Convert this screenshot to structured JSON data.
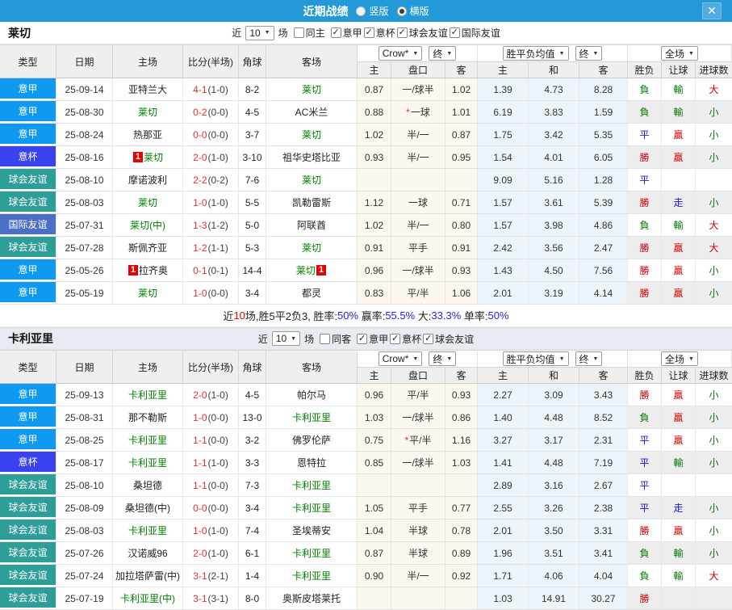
{
  "titlebar": {
    "title": "近期战绩",
    "radio_vertical": "竖版",
    "radio_horizontal": "横版",
    "selected": "横版",
    "close_label": "✕",
    "bar_color": "#2399d8"
  },
  "filters": {
    "near_label": "近",
    "near_value": "10",
    "games_label": "场"
  },
  "columns": {
    "left": [
      "类型",
      "日期",
      "主场",
      "比分(半场)",
      "角球",
      "客场"
    ],
    "right": [
      "主",
      "盘口",
      "客",
      "主",
      "和",
      "客",
      "胜负",
      "让球",
      "进球数"
    ],
    "sel_company": "Crow*",
    "sel_final1": "终",
    "sel_avg": "胜平负均值",
    "sel_final2": "终",
    "sel_scope": "全场"
  },
  "type_colors": {
    "意甲": "#0d9af0",
    "意杯": "#3a41ee",
    "球会友谊": "#2e9e99",
    "国际友谊": "#4a6fc4"
  },
  "palette": {
    "r": "#d40000",
    "b": "#1616d6",
    "g": "#067806"
  },
  "focus_team_color": "#008000",
  "sections": [
    {
      "team": "莱切",
      "same_label": "同主",
      "leagues": [
        "意甲",
        "意杯",
        "球会友谊",
        "国际友谊"
      ],
      "rows": [
        {
          "type": "意甲",
          "date": "25-09-14",
          "home": "亚特兰大",
          "home_focus": false,
          "home_rc": "",
          "home_rc_pos": "pre",
          "score": "4-1",
          "half": "(1-0)",
          "corner": "8-2",
          "away": "莱切",
          "away_focus": true,
          "away_rc": "",
          "away_rc_pos": "post",
          "h": "0.87",
          "hcap": "一/球半",
          "hcap_star": false,
          "a": "1.02",
          "avg_h": "1.39",
          "avg_d": "4.73",
          "avg_a": "8.28",
          "wl": "負",
          "wl_c": "g",
          "hc": "輸",
          "hc_c": "g",
          "ou": "大",
          "ou_c": "r"
        },
        {
          "type": "意甲",
          "date": "25-08-30",
          "home": "莱切",
          "home_focus": true,
          "home_rc": "",
          "home_rc_pos": "pre",
          "score": "0-2",
          "half": "(0-0)",
          "corner": "4-5",
          "away": "AC米兰",
          "away_focus": false,
          "away_rc": "",
          "away_rc_pos": "post",
          "h": "0.88",
          "hcap": "一球",
          "hcap_star": true,
          "a": "1.01",
          "avg_h": "6.19",
          "avg_d": "3.83",
          "avg_a": "1.59",
          "wl": "負",
          "wl_c": "g",
          "hc": "輸",
          "hc_c": "g",
          "ou": "小",
          "ou_c": "g"
        },
        {
          "type": "意甲",
          "date": "25-08-24",
          "home": "热那亚",
          "home_focus": false,
          "home_rc": "",
          "home_rc_pos": "pre",
          "score": "0-0",
          "half": "(0-0)",
          "corner": "3-7",
          "away": "莱切",
          "away_focus": true,
          "away_rc": "",
          "away_rc_pos": "post",
          "h": "1.02",
          "hcap": "半/一",
          "hcap_star": false,
          "a": "0.87",
          "avg_h": "1.75",
          "avg_d": "3.42",
          "avg_a": "5.35",
          "wl": "平",
          "wl_c": "b",
          "hc": "贏",
          "hc_c": "r",
          "ou": "小",
          "ou_c": "g"
        },
        {
          "type": "意杯",
          "date": "25-08-16",
          "home": "莱切",
          "home_focus": true,
          "home_rc": "1",
          "home_rc_pos": "pre",
          "score": "2-0",
          "half": "(1-0)",
          "corner": "3-10",
          "away": "祖华史塔比亚",
          "away_focus": false,
          "away_rc": "",
          "away_rc_pos": "post",
          "h": "0.93",
          "hcap": "半/一",
          "hcap_star": false,
          "a": "0.95",
          "avg_h": "1.54",
          "avg_d": "4.01",
          "avg_a": "6.05",
          "wl": "勝",
          "wl_c": "r",
          "hc": "贏",
          "hc_c": "r",
          "ou": "小",
          "ou_c": "g"
        },
        {
          "type": "球会友谊",
          "date": "25-08-10",
          "home": "摩诺波利",
          "home_focus": false,
          "home_rc": "",
          "home_rc_pos": "pre",
          "score": "2-2",
          "half": "(0-2)",
          "corner": "7-6",
          "away": "莱切",
          "away_focus": true,
          "away_rc": "",
          "away_rc_pos": "post",
          "h": "",
          "hcap": "",
          "hcap_star": false,
          "a": "",
          "avg_h": "9.09",
          "avg_d": "5.16",
          "avg_a": "1.28",
          "wl": "平",
          "wl_c": "b",
          "hc": "",
          "hc_c": "b",
          "ou": "",
          "ou_c": "g"
        },
        {
          "type": "球会友谊",
          "date": "25-08-03",
          "home": "莱切",
          "home_focus": true,
          "home_rc": "",
          "home_rc_pos": "pre",
          "score": "1-0",
          "half": "(1-0)",
          "corner": "5-5",
          "away": "凯勒雷斯",
          "away_focus": false,
          "away_rc": "",
          "away_rc_pos": "post",
          "h": "1.12",
          "hcap": "一球",
          "hcap_star": false,
          "a": "0.71",
          "avg_h": "1.57",
          "avg_d": "3.61",
          "avg_a": "5.39",
          "wl": "勝",
          "wl_c": "r",
          "hc": "走",
          "hc_c": "b",
          "ou": "小",
          "ou_c": "g"
        },
        {
          "type": "国际友谊",
          "date": "25-07-31",
          "home": "莱切(中)",
          "home_focus": true,
          "home_rc": "",
          "home_rc_pos": "pre",
          "score": "1-3",
          "half": "(1-2)",
          "corner": "5-0",
          "away": "阿联酋",
          "away_focus": false,
          "away_rc": "",
          "away_rc_pos": "post",
          "h": "1.02",
          "hcap": "半/一",
          "hcap_star": false,
          "a": "0.80",
          "avg_h": "1.57",
          "avg_d": "3.98",
          "avg_a": "4.86",
          "wl": "負",
          "wl_c": "g",
          "hc": "輸",
          "hc_c": "g",
          "ou": "大",
          "ou_c": "r"
        },
        {
          "type": "球会友谊",
          "date": "25-07-28",
          "home": "斯佩齐亚",
          "home_focus": false,
          "home_rc": "",
          "home_rc_pos": "pre",
          "score": "1-2",
          "half": "(1-1)",
          "corner": "5-3",
          "away": "莱切",
          "away_focus": true,
          "away_rc": "",
          "away_rc_pos": "post",
          "h": "0.91",
          "hcap": "平手",
          "hcap_star": false,
          "a": "0.91",
          "avg_h": "2.42",
          "avg_d": "3.56",
          "avg_a": "2.47",
          "wl": "勝",
          "wl_c": "r",
          "hc": "贏",
          "hc_c": "r",
          "ou": "大",
          "ou_c": "r"
        },
        {
          "type": "意甲",
          "date": "25-05-26",
          "home": "拉齐奥",
          "home_focus": false,
          "home_rc": "1",
          "home_rc_pos": "pre",
          "score": "0-1",
          "half": "(0-1)",
          "corner": "14-4",
          "away": "莱切",
          "away_focus": true,
          "away_rc": "1",
          "away_rc_pos": "post",
          "h": "0.96",
          "hcap": "一/球半",
          "hcap_star": false,
          "a": "0.93",
          "avg_h": "1.43",
          "avg_d": "4.50",
          "avg_a": "7.56",
          "wl": "勝",
          "wl_c": "r",
          "hc": "贏",
          "hc_c": "r",
          "ou": "小",
          "ou_c": "g"
        },
        {
          "type": "意甲",
          "date": "25-05-19",
          "home": "莱切",
          "home_focus": true,
          "home_rc": "",
          "home_rc_pos": "pre",
          "score": "1-0",
          "half": "(0-0)",
          "corner": "3-4",
          "away": "都灵",
          "away_focus": false,
          "away_rc": "",
          "away_rc_pos": "post",
          "h": "0.83",
          "hcap": "平/半",
          "hcap_star": false,
          "a": "1.06",
          "avg_h": "2.01",
          "avg_d": "3.19",
          "avg_a": "4.14",
          "wl": "勝",
          "wl_c": "r",
          "hc": "贏",
          "hc_c": "r",
          "ou": "小",
          "ou_c": "g"
        }
      ],
      "summary": [
        {
          "t": "近",
          "c": "k"
        },
        {
          "t": "10",
          "c": "r"
        },
        {
          "t": "场,胜5平2负3, 胜率:",
          "c": "k"
        },
        {
          "t": "50%",
          "c": "b"
        },
        {
          "t": " 赢率:",
          "c": "k"
        },
        {
          "t": "55.5%",
          "c": "b"
        },
        {
          "t": " 大:",
          "c": "k"
        },
        {
          "t": "33.3%",
          "c": "b"
        },
        {
          "t": " 单率:",
          "c": "k"
        },
        {
          "t": "50%",
          "c": "b"
        }
      ]
    },
    {
      "team": "卡利亚里",
      "same_label": "同客",
      "leagues": [
        "意甲",
        "意杯",
        "球会友谊"
      ],
      "rows": [
        {
          "type": "意甲",
          "date": "25-09-13",
          "home": "卡利亚里",
          "home_focus": true,
          "home_rc": "",
          "home_rc_pos": "pre",
          "score": "2-0",
          "half": "(1-0)",
          "corner": "4-5",
          "away": "帕尔马",
          "away_focus": false,
          "away_rc": "",
          "away_rc_pos": "post",
          "h": "0.96",
          "hcap": "平/半",
          "hcap_star": false,
          "a": "0.93",
          "avg_h": "2.27",
          "avg_d": "3.09",
          "avg_a": "3.43",
          "wl": "勝",
          "wl_c": "r",
          "hc": "贏",
          "hc_c": "r",
          "ou": "小",
          "ou_c": "g"
        },
        {
          "type": "意甲",
          "date": "25-08-31",
          "home": "那不勒斯",
          "home_focus": false,
          "home_rc": "",
          "home_rc_pos": "pre",
          "score": "1-0",
          "half": "(0-0)",
          "corner": "13-0",
          "away": "卡利亚里",
          "away_focus": true,
          "away_rc": "",
          "away_rc_pos": "post",
          "h": "1.03",
          "hcap": "一/球半",
          "hcap_star": false,
          "a": "0.86",
          "avg_h": "1.40",
          "avg_d": "4.48",
          "avg_a": "8.52",
          "wl": "負",
          "wl_c": "g",
          "hc": "贏",
          "hc_c": "r",
          "ou": "小",
          "ou_c": "g"
        },
        {
          "type": "意甲",
          "date": "25-08-25",
          "home": "卡利亚里",
          "home_focus": true,
          "home_rc": "",
          "home_rc_pos": "pre",
          "score": "1-1",
          "half": "(0-0)",
          "corner": "3-2",
          "away": "佛罗伦萨",
          "away_focus": false,
          "away_rc": "",
          "away_rc_pos": "post",
          "h": "0.75",
          "hcap": "平/半",
          "hcap_star": true,
          "a": "1.16",
          "avg_h": "3.27",
          "avg_d": "3.17",
          "avg_a": "2.31",
          "wl": "平",
          "wl_c": "b",
          "hc": "贏",
          "hc_c": "r",
          "ou": "小",
          "ou_c": "g"
        },
        {
          "type": "意杯",
          "date": "25-08-17",
          "home": "卡利亚里",
          "home_focus": true,
          "home_rc": "",
          "home_rc_pos": "pre",
          "score": "1-1",
          "half": "(1-0)",
          "corner": "3-3",
          "away": "恩特拉",
          "away_focus": false,
          "away_rc": "",
          "away_rc_pos": "post",
          "h": "0.85",
          "hcap": "一/球半",
          "hcap_star": false,
          "a": "1.03",
          "avg_h": "1.41",
          "avg_d": "4.48",
          "avg_a": "7.19",
          "wl": "平",
          "wl_c": "b",
          "hc": "輸",
          "hc_c": "g",
          "ou": "小",
          "ou_c": "g"
        },
        {
          "type": "球会友谊",
          "date": "25-08-10",
          "home": "桑坦德",
          "home_focus": false,
          "home_rc": "",
          "home_rc_pos": "pre",
          "score": "1-1",
          "half": "(0-0)",
          "corner": "7-3",
          "away": "卡利亚里",
          "away_focus": true,
          "away_rc": "",
          "away_rc_pos": "post",
          "h": "",
          "hcap": "",
          "hcap_star": false,
          "a": "",
          "avg_h": "2.89",
          "avg_d": "3.16",
          "avg_a": "2.67",
          "wl": "平",
          "wl_c": "b",
          "hc": "",
          "hc_c": "b",
          "ou": "",
          "ou_c": "g"
        },
        {
          "type": "球会友谊",
          "date": "25-08-09",
          "home": "桑坦德(中)",
          "home_focus": false,
          "home_rc": "",
          "home_rc_pos": "pre",
          "score": "0-0",
          "half": "(0-0)",
          "corner": "3-4",
          "away": "卡利亚里",
          "away_focus": true,
          "away_rc": "",
          "away_rc_pos": "post",
          "h": "1.05",
          "hcap": "平手",
          "hcap_star": false,
          "a": "0.77",
          "avg_h": "2.55",
          "avg_d": "3.26",
          "avg_a": "2.38",
          "wl": "平",
          "wl_c": "b",
          "hc": "走",
          "hc_c": "b",
          "ou": "小",
          "ou_c": "g"
        },
        {
          "type": "球会友谊",
          "date": "25-08-03",
          "home": "卡利亚里",
          "home_focus": true,
          "home_rc": "",
          "home_rc_pos": "pre",
          "score": "1-0",
          "half": "(1-0)",
          "corner": "7-4",
          "away": "圣埃蒂安",
          "away_focus": false,
          "away_rc": "",
          "away_rc_pos": "post",
          "h": "1.04",
          "hcap": "半球",
          "hcap_star": false,
          "a": "0.78",
          "avg_h": "2.01",
          "avg_d": "3.50",
          "avg_a": "3.31",
          "wl": "勝",
          "wl_c": "r",
          "hc": "贏",
          "hc_c": "r",
          "ou": "小",
          "ou_c": "g"
        },
        {
          "type": "球会友谊",
          "date": "25-07-26",
          "home": "汉诺威96",
          "home_focus": false,
          "home_rc": "",
          "home_rc_pos": "pre",
          "score": "2-0",
          "half": "(1-0)",
          "corner": "6-1",
          "away": "卡利亚里",
          "away_focus": true,
          "away_rc": "",
          "away_rc_pos": "post",
          "h": "0.87",
          "hcap": "半球",
          "hcap_star": false,
          "a": "0.89",
          "avg_h": "1.96",
          "avg_d": "3.51",
          "avg_a": "3.41",
          "wl": "負",
          "wl_c": "g",
          "hc": "輸",
          "hc_c": "g",
          "ou": "小",
          "ou_c": "g"
        },
        {
          "type": "球会友谊",
          "date": "25-07-24",
          "home": "加拉塔萨雷(中)",
          "home_focus": false,
          "home_rc": "",
          "home_rc_pos": "pre",
          "score": "3-1",
          "half": "(2-1)",
          "corner": "1-4",
          "away": "卡利亚里",
          "away_focus": true,
          "away_rc": "",
          "away_rc_pos": "post",
          "h": "0.90",
          "hcap": "半/一",
          "hcap_star": false,
          "a": "0.92",
          "avg_h": "1.71",
          "avg_d": "4.06",
          "avg_a": "4.04",
          "wl": "負",
          "wl_c": "g",
          "hc": "輸",
          "hc_c": "g",
          "ou": "大",
          "ou_c": "r"
        },
        {
          "type": "球会友谊",
          "date": "25-07-19",
          "home": "卡利亚里(中)",
          "home_focus": true,
          "home_rc": "",
          "home_rc_pos": "pre",
          "score": "3-1",
          "half": "(3-1)",
          "corner": "8-0",
          "away": "奥斯皮塔莱托",
          "away_focus": false,
          "away_rc": "",
          "away_rc_pos": "post",
          "h": "",
          "hcap": "",
          "hcap_star": false,
          "a": "",
          "avg_h": "1.03",
          "avg_d": "14.91",
          "avg_a": "30.27",
          "wl": "勝",
          "wl_c": "r",
          "hc": "",
          "hc_c": "b",
          "ou": "",
          "ou_c": "g"
        }
      ],
      "summary": null
    }
  ]
}
